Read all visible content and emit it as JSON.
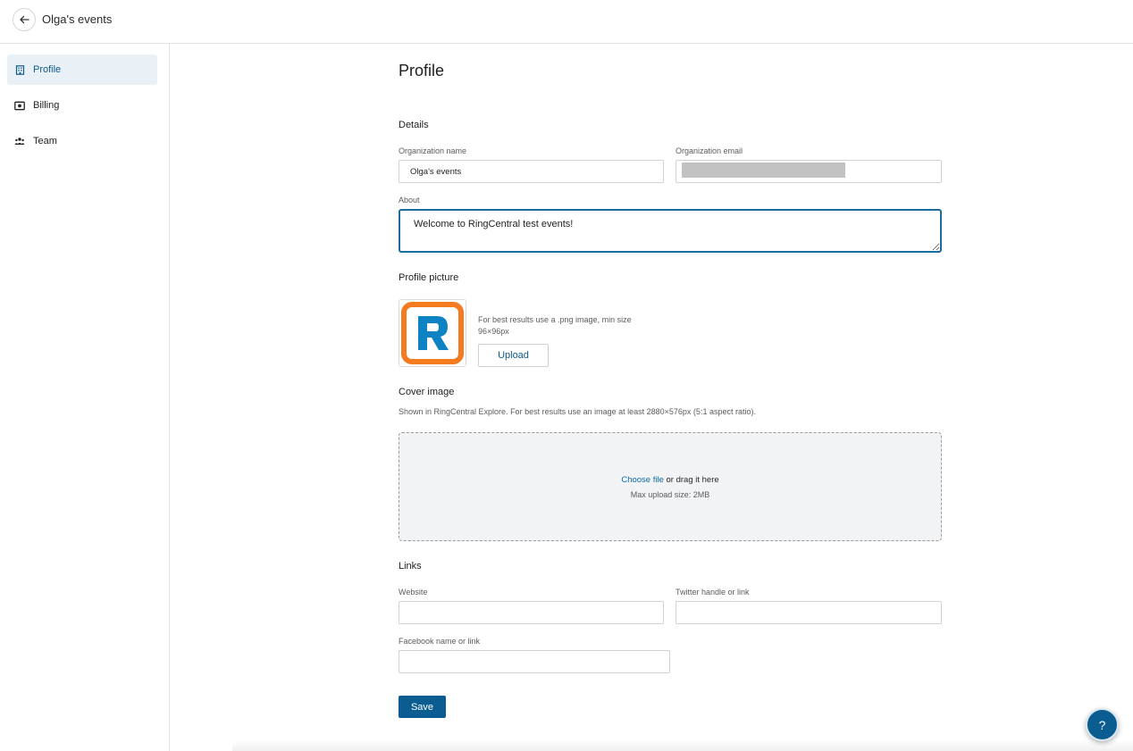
{
  "header": {
    "title": "Olga's events",
    "back_icon": "arrow-left-icon"
  },
  "sidebar": {
    "items": [
      {
        "label": "Profile",
        "icon": "building-icon",
        "active": true
      },
      {
        "label": "Billing",
        "icon": "money-icon",
        "active": false
      },
      {
        "label": "Team",
        "icon": "team-icon",
        "active": false
      }
    ]
  },
  "main": {
    "title": "Profile",
    "details": {
      "section_title": "Details",
      "org_name_label": "Organization name",
      "org_name_value": "Olga's events",
      "org_email_label": "Organization email",
      "about_label": "About",
      "about_value": "Welcome to RingCentral test events!"
    },
    "profile_picture": {
      "section_title": "Profile picture",
      "hint": "For best results use a .png image, min size 96×96px",
      "upload_label": "Upload"
    },
    "cover_image": {
      "section_title": "Cover image",
      "hint": "Shown in RingCentral Explore. For best results use an image at least 2880×576px (5:1 aspect ratio).",
      "choose_file": "Choose file",
      "drag_text": " or drag it here",
      "max_size": "Max upload size: 2MB"
    },
    "links": {
      "section_title": "Links",
      "website_label": "Website",
      "twitter_label": "Twitter handle or link",
      "facebook_label": "Facebook name or link"
    },
    "save_label": "Save"
  },
  "help": {
    "label": "?"
  },
  "colors": {
    "accent": "#0b5d91",
    "active_nav_bg": "#e9f1f7",
    "logo_orange": "#f47b20",
    "logo_blue": "#0e83c4"
  }
}
